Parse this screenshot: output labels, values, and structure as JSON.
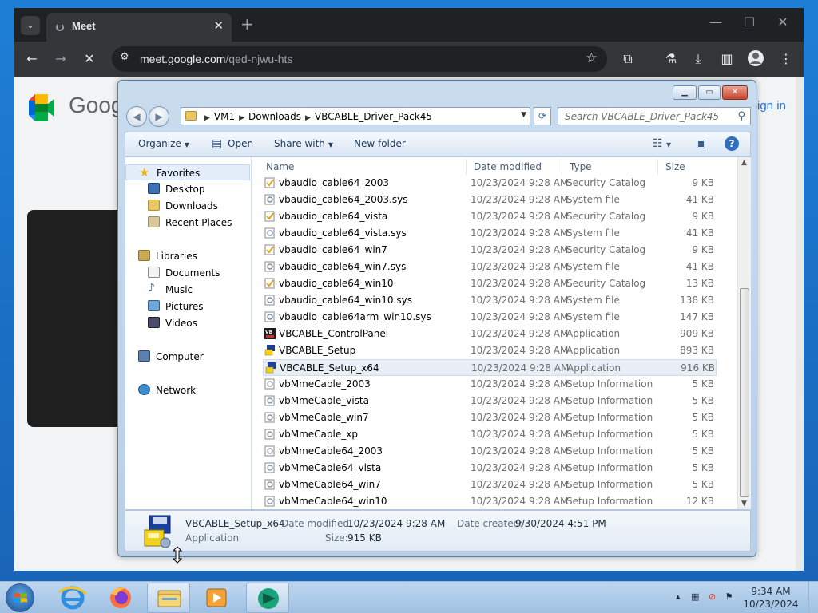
{
  "chrome": {
    "tab_title": "Meet",
    "tab_close": "✕",
    "new_tab": "+",
    "url_host": "meet.google.com",
    "url_path": "/qed-njwu-hts",
    "page_brand": "Goog",
    "sign_in": "Sign in"
  },
  "explorer": {
    "breadcrumbs": [
      "VM1",
      "Downloads",
      "VBCABLE_Driver_Pack45"
    ],
    "search_placeholder": "Search VBCABLE_Driver_Pack45",
    "commands": {
      "organize": "Organize",
      "open": "Open",
      "share_with": "Share with",
      "new_folder": "New folder"
    },
    "nav": {
      "favorites": "Favorites",
      "desktop": "Desktop",
      "downloads": "Downloads",
      "recent_places": "Recent Places",
      "libraries": "Libraries",
      "documents": "Documents",
      "music": "Music",
      "pictures": "Pictures",
      "videos": "Videos",
      "computer": "Computer",
      "network": "Network"
    },
    "columns": {
      "name": "Name",
      "date": "Date modified",
      "type": "Type",
      "size": "Size"
    },
    "files": [
      {
        "name": "vbaudio_cable64_2003",
        "date": "10/23/2024 9:28 AM",
        "type": "Security Catalog",
        "size": "9 KB",
        "icon": "catalog"
      },
      {
        "name": "vbaudio_cable64_2003.sys",
        "date": "10/23/2024 9:28 AM",
        "type": "System file",
        "size": "41 KB",
        "icon": "sys"
      },
      {
        "name": "vbaudio_cable64_vista",
        "date": "10/23/2024 9:28 AM",
        "type": "Security Catalog",
        "size": "9 KB",
        "icon": "catalog"
      },
      {
        "name": "vbaudio_cable64_vista.sys",
        "date": "10/23/2024 9:28 AM",
        "type": "System file",
        "size": "41 KB",
        "icon": "sys"
      },
      {
        "name": "vbaudio_cable64_win7",
        "date": "10/23/2024 9:28 AM",
        "type": "Security Catalog",
        "size": "9 KB",
        "icon": "catalog"
      },
      {
        "name": "vbaudio_cable64_win7.sys",
        "date": "10/23/2024 9:28 AM",
        "type": "System file",
        "size": "41 KB",
        "icon": "sys"
      },
      {
        "name": "vbaudio_cable64_win10",
        "date": "10/23/2024 9:28 AM",
        "type": "Security Catalog",
        "size": "13 KB",
        "icon": "catalog"
      },
      {
        "name": "vbaudio_cable64_win10.sys",
        "date": "10/23/2024 9:28 AM",
        "type": "System file",
        "size": "138 KB",
        "icon": "sys"
      },
      {
        "name": "vbaudio_cable64arm_win10.sys",
        "date": "10/23/2024 9:28 AM",
        "type": "System file",
        "size": "147 KB",
        "icon": "sys"
      },
      {
        "name": "VBCABLE_ControlPanel",
        "date": "10/23/2024 9:28 AM",
        "type": "Application",
        "size": "909 KB",
        "icon": "app-vb"
      },
      {
        "name": "VBCABLE_Setup",
        "date": "10/23/2024 9:28 AM",
        "type": "Application",
        "size": "893 KB",
        "icon": "app-setup"
      },
      {
        "name": "VBCABLE_Setup_x64",
        "date": "10/23/2024 9:28 AM",
        "type": "Application",
        "size": "916 KB",
        "icon": "app-setup",
        "selected": true
      },
      {
        "name": "vbMmeCable_2003",
        "date": "10/23/2024 9:28 AM",
        "type": "Setup Information",
        "size": "5 KB",
        "icon": "inf"
      },
      {
        "name": "vbMmeCable_vista",
        "date": "10/23/2024 9:28 AM",
        "type": "Setup Information",
        "size": "5 KB",
        "icon": "inf"
      },
      {
        "name": "vbMmeCable_win7",
        "date": "10/23/2024 9:28 AM",
        "type": "Setup Information",
        "size": "5 KB",
        "icon": "inf"
      },
      {
        "name": "vbMmeCable_xp",
        "date": "10/23/2024 9:28 AM",
        "type": "Setup Information",
        "size": "5 KB",
        "icon": "inf"
      },
      {
        "name": "vbMmeCable64_2003",
        "date": "10/23/2024 9:28 AM",
        "type": "Setup Information",
        "size": "5 KB",
        "icon": "inf"
      },
      {
        "name": "vbMmeCable64_vista",
        "date": "10/23/2024 9:28 AM",
        "type": "Setup Information",
        "size": "5 KB",
        "icon": "inf"
      },
      {
        "name": "vbMmeCable64_win7",
        "date": "10/23/2024 9:28 AM",
        "type": "Setup Information",
        "size": "5 KB",
        "icon": "inf"
      },
      {
        "name": "vbMmeCable64_win10",
        "date": "10/23/2024 9:28 AM",
        "type": "Setup Information",
        "size": "12 KB",
        "icon": "inf"
      }
    ],
    "details": {
      "name": "VBCABLE_Setup_x64",
      "kind": "Application",
      "date_modified_label": "Date modified:",
      "date_modified": "10/23/2024 9:28 AM",
      "date_created_label": "Date created:",
      "date_created": "9/30/2024 4:51 PM",
      "size_label": "Size:",
      "size": "915 KB"
    }
  },
  "taskbar": {
    "time": "9:34 AM",
    "date": "10/23/2024"
  },
  "colors": {
    "desktop_blue": "#1f7fd6",
    "chrome_dark": "#202124",
    "selection": "#e8eef6",
    "link_blue": "#1a73e8"
  }
}
